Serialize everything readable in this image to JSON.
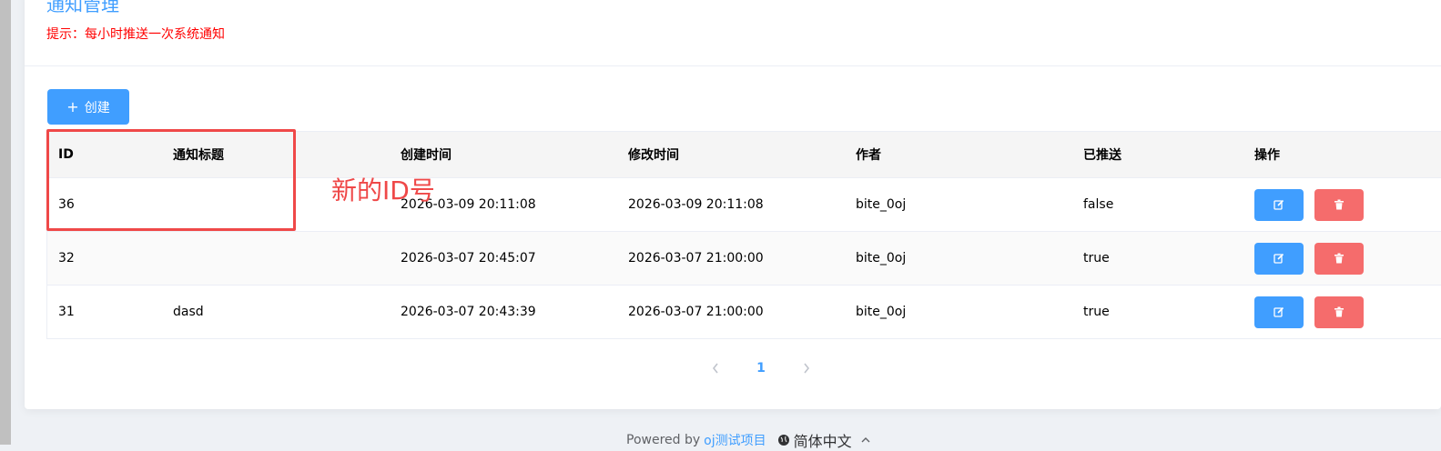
{
  "header": {
    "title": "通知管理",
    "hint": "提示：每小时推送一次系统通知"
  },
  "toolbar": {
    "create_label": "创建"
  },
  "table": {
    "columns": [
      "ID",
      "通知标题",
      "创建时间",
      "修改时间",
      "作者",
      "已推送",
      "操作"
    ],
    "rows": [
      {
        "id": "36",
        "title": "",
        "created": "2026-03-09 20:11:08",
        "modified": "2026-03-09 20:11:08",
        "author": "bite_0oj",
        "pushed": "false"
      },
      {
        "id": "32",
        "title": "",
        "created": "2026-03-07 20:45:07",
        "modified": "2026-03-07 21:00:00",
        "author": "bite_0oj",
        "pushed": "true"
      },
      {
        "id": "31",
        "title": "dasd",
        "created": "2026-03-07 20:43:39",
        "modified": "2026-03-07 21:00:00",
        "author": "bite_0oj",
        "pushed": "true"
      }
    ]
  },
  "annotation": {
    "text": "新的ID号",
    "color": "#ef4848"
  },
  "pagination": {
    "current_page": "1"
  },
  "footer": {
    "powered_by": "Powered by",
    "project_link": "oj测试项目",
    "language": "简体中文"
  },
  "colors": {
    "primary": "#409eff",
    "danger": "#f56c6c",
    "hint": "#ff0000"
  }
}
